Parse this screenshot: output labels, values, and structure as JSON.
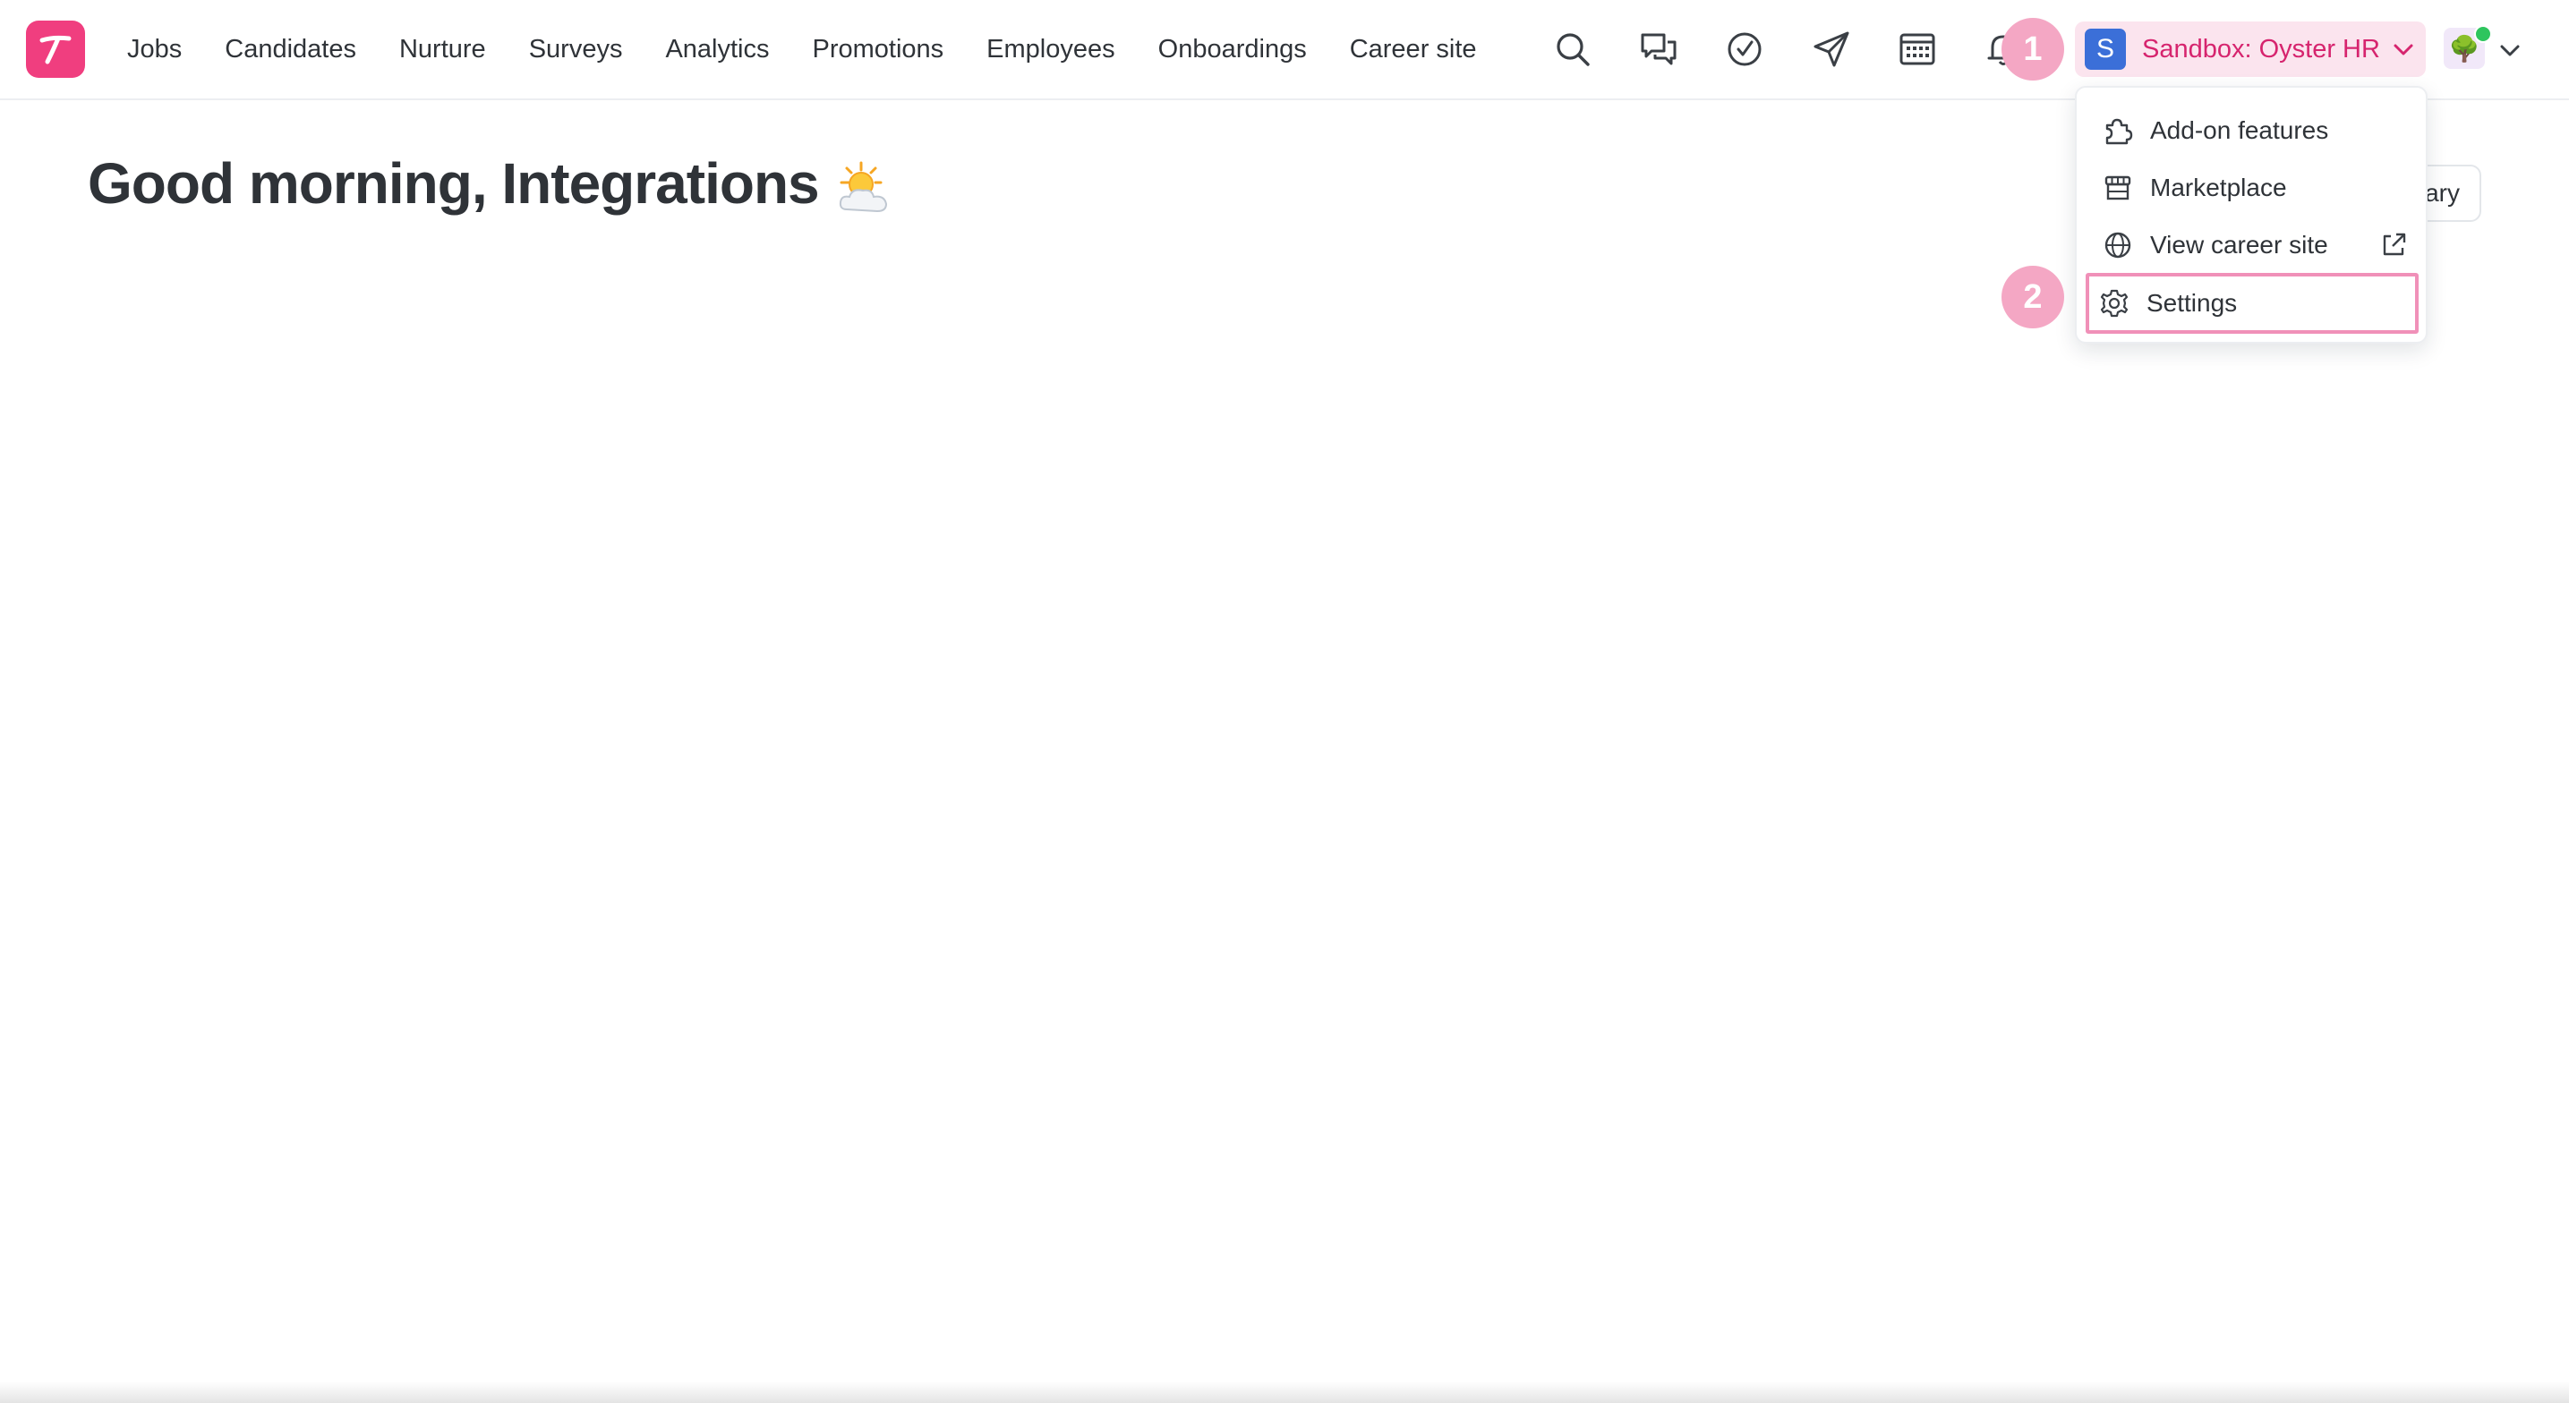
{
  "app": {
    "logo_letter": "T",
    "brand_color": "#f03e7f"
  },
  "nav": {
    "items": [
      {
        "label": "Jobs"
      },
      {
        "label": "Candidates"
      },
      {
        "label": "Nurture"
      },
      {
        "label": "Surveys"
      },
      {
        "label": "Analytics"
      },
      {
        "label": "Promotions"
      },
      {
        "label": "Employees"
      },
      {
        "label": "Onboardings"
      },
      {
        "label": "Career site"
      }
    ]
  },
  "toolbar_icons": [
    "search-icon",
    "messages-icon",
    "tasks-check-icon",
    "send-icon",
    "calendar-icon",
    "bell-icon"
  ],
  "workspace": {
    "badge_letter": "S",
    "name": "Sandbox: Oyster HR",
    "text_color": "#d6246e",
    "bg_color": "#fbe4ee"
  },
  "user": {
    "avatar_emoji": "🌳",
    "status": "online"
  },
  "main": {
    "greeting": "Good morning, Integrations",
    "partial_button_text": "ary"
  },
  "dropdown": {
    "items": [
      {
        "label": "Add-on features",
        "icon": "puzzle-icon"
      },
      {
        "label": "Marketplace",
        "icon": "store-icon"
      },
      {
        "label": "View career site",
        "icon": "globe-icon",
        "trailing_icon": "external-link-icon"
      },
      {
        "label": "Settings",
        "icon": "gear-icon",
        "highlighted": true
      }
    ]
  },
  "annotations": {
    "step1": "1",
    "step2": "2",
    "color": "#f4a7c4"
  }
}
